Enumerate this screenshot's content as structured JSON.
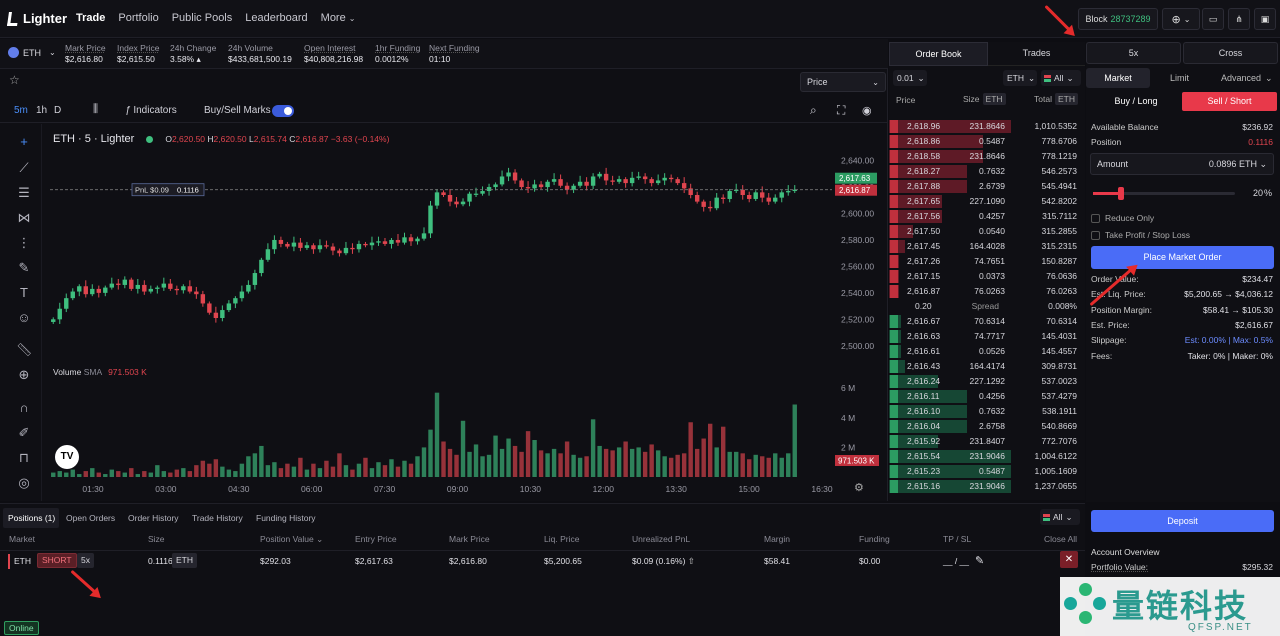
{
  "app": {
    "name": "Lighter"
  },
  "nav": {
    "items": [
      "Trade",
      "Portfolio",
      "Public Pools",
      "Leaderboard",
      "More"
    ]
  },
  "block": {
    "label": "Block",
    "number": "28737289"
  },
  "market": {
    "symbol": "ETH"
  },
  "ticker": [
    {
      "label": "Mark Price",
      "value": "$2,616.80"
    },
    {
      "label": "Index Price",
      "value": "$2,615.50"
    },
    {
      "label": "24h Change",
      "value": "3.58%"
    },
    {
      "label": "24h Volume",
      "value": "$433,681,500.19"
    },
    {
      "label": "Open Interest",
      "value": "$40,808,216.98"
    },
    {
      "label": "1hr Funding",
      "value": "0.0012%"
    },
    {
      "label": "Next Funding",
      "value": "01:10"
    }
  ],
  "chart_toolbar": {
    "intervals": [
      "5m",
      "1h",
      "D"
    ],
    "indicators": "Indicators",
    "marks": "Buy/Sell Marks",
    "price_select": "Price"
  },
  "chart_data": {
    "type": "candlestick",
    "title": "ETH · 5 · Lighter",
    "ohlc": {
      "o": "2,620.50",
      "h": "2,620.50",
      "l": "2,615.74",
      "c": "2,616.87",
      "change": "−3.63 (−0.14%)"
    },
    "ylim": [
      2490,
      2645
    ],
    "yticks": [
      "2,640.00",
      "2,620.00",
      "2,600.00",
      "2,580.00",
      "2,560.00",
      "2,540.00",
      "2,520.00",
      "2,500.00"
    ],
    "xticks": [
      "01:30",
      "03:00",
      "04:30",
      "06:00",
      "07:30",
      "09:00",
      "10:30",
      "12:00",
      "13:30",
      "15:00",
      "16:30"
    ],
    "price_labels": {
      "last": "2,617.63",
      "mark": "2,616.87"
    },
    "pnl_label": "PnL $0.09",
    "position_size": "0.1116",
    "volume": {
      "label": "Volume",
      "sma_label": "SMA",
      "sma": "971.503 K",
      "yticks": [
        "6 M",
        "4 M",
        "2 M"
      ],
      "last": "971.503 K"
    },
    "closes": [
      2520,
      2528,
      2536,
      2541,
      2545,
      2539,
      2543,
      2540,
      2544,
      2547,
      2546,
      2550,
      2543,
      2546,
      2541,
      2543,
      2544,
      2547,
      2543,
      2542,
      2545,
      2541,
      2539,
      2532,
      2525,
      2521,
      2527,
      2532,
      2536,
      2541,
      2546,
      2555,
      2565,
      2573,
      2580,
      2577,
      2575,
      2578,
      2574,
      2576,
      2573,
      2576,
      2575,
      2572,
      2570,
      2574,
      2573,
      2577,
      2576,
      2578,
      2579,
      2577,
      2580,
      2578,
      2582,
      2579,
      2581,
      2585,
      2606,
      2616,
      2614,
      2609,
      2607,
      2609,
      2615,
      2615,
      2617,
      2620,
      2622,
      2628,
      2631,
      2625,
      2620,
      2619,
      2622,
      2620,
      2624,
      2626,
      2621,
      2618,
      2621,
      2624,
      2621,
      2628,
      2630,
      2625,
      2624,
      2626,
      2623,
      2627,
      2628,
      2626,
      2623,
      2625,
      2627,
      2626,
      2623,
      2619,
      2614,
      2609,
      2605,
      2604,
      2612,
      2611,
      2617,
      2618,
      2614,
      2611,
      2616,
      2612,
      2609,
      2612,
      2616,
      2617,
      2618
    ],
    "volumes": [
      0.3,
      0.4,
      0.3,
      0.5,
      0.2,
      0.4,
      0.6,
      0.3,
      0.2,
      0.5,
      0.4,
      0.3,
      0.6,
      0.2,
      0.4,
      0.3,
      0.8,
      0.4,
      0.3,
      0.5,
      0.6,
      0.4,
      0.8,
      1.1,
      0.9,
      1.2,
      0.7,
      0.5,
      0.4,
      0.9,
      1.4,
      1.6,
      2.1,
      0.8,
      1.0,
      0.6,
      0.9,
      0.7,
      1.3,
      0.5,
      0.9,
      0.6,
      1.1,
      0.7,
      1.6,
      0.8,
      0.5,
      0.9,
      1.3,
      0.6,
      1.0,
      0.8,
      1.2,
      0.7,
      1.1,
      0.9,
      1.4,
      2.0,
      3.2,
      5.7,
      2.4,
      1.9,
      1.5,
      3.8,
      1.7,
      2.2,
      1.4,
      1.5,
      2.8,
      1.9,
      2.6,
      2.1,
      1.7,
      3.1,
      2.5,
      1.8,
      1.6,
      1.9,
      1.6,
      2.4,
      1.5,
      1.3,
      1.4,
      3.9,
      2.1,
      1.9,
      1.8,
      2.0,
      2.4,
      1.9,
      2.0,
      1.7,
      2.2,
      1.8,
      1.4,
      1.3,
      1.5,
      1.6,
      3.7,
      1.9,
      2.6,
      3.6,
      2.0,
      3.4,
      1.7,
      1.7,
      1.6,
      1.2,
      1.5,
      1.4,
      1.3,
      1.6,
      1.3,
      1.6,
      4.9
    ]
  },
  "orderbook": {
    "tabs": [
      "Order Book",
      "Trades"
    ],
    "tick": "0.01",
    "asset": "ETH",
    "filter": "All",
    "headers": {
      "price": "Price",
      "size": "Size",
      "total": "Total",
      "unit": "ETH"
    },
    "asks": [
      {
        "price": "2,618.96",
        "size": "231.8646",
        "total": "1,010.5352",
        "depth": 0.62
      },
      {
        "price": "2,618.86",
        "size": "0.5487",
        "total": "778.6706",
        "depth": 0.48
      },
      {
        "price": "2,618.58",
        "size": "231.8646",
        "total": "778.1219",
        "depth": 0.48
      },
      {
        "price": "2,618.27",
        "size": "0.7632",
        "total": "546.2573",
        "depth": 0.4
      },
      {
        "price": "2,617.88",
        "size": "2.6739",
        "total": "545.4941",
        "depth": 0.4
      },
      {
        "price": "2,617.65",
        "size": "227.1090",
        "total": "542.8202",
        "depth": 0.27
      },
      {
        "price": "2,617.56",
        "size": "0.4257",
        "total": "315.7112",
        "depth": 0.27
      },
      {
        "price": "2,617.50",
        "size": "0.0540",
        "total": "315.2855",
        "depth": 0.12
      },
      {
        "price": "2,617.45",
        "size": "164.4028",
        "total": "315.2315",
        "depth": 0.08
      },
      {
        "price": "2,617.26",
        "size": "74.7651",
        "total": "150.8287",
        "depth": 0.05
      },
      {
        "price": "2,617.15",
        "size": "0.0373",
        "total": "76.0636",
        "depth": 0.05
      },
      {
        "price": "2,616.87",
        "size": "76.0263",
        "total": "76.0263",
        "depth": 0.05
      }
    ],
    "spread": {
      "value": "0.20",
      "label": "Spread",
      "pct": "0.008%"
    },
    "bids": [
      {
        "price": "2,616.67",
        "size": "70.6314",
        "total": "70.6314",
        "depth": 0.06
      },
      {
        "price": "2,616.63",
        "size": "74.7717",
        "total": "145.4031",
        "depth": 0.06
      },
      {
        "price": "2,616.61",
        "size": "0.0526",
        "total": "145.4557",
        "depth": 0.06
      },
      {
        "price": "2,616.43",
        "size": "164.4174",
        "total": "309.8731",
        "depth": 0.08
      },
      {
        "price": "2,616.24",
        "size": "227.1292",
        "total": "537.0023",
        "depth": 0.25
      },
      {
        "price": "2,616.11",
        "size": "0.4256",
        "total": "537.4279",
        "depth": 0.4
      },
      {
        "price": "2,616.10",
        "size": "0.7632",
        "total": "538.1911",
        "depth": 0.4
      },
      {
        "price": "2,616.04",
        "size": "2.6758",
        "total": "540.8669",
        "depth": 0.4
      },
      {
        "price": "2,615.92",
        "size": "231.8407",
        "total": "772.7076",
        "depth": 0.25
      },
      {
        "price": "2,615.54",
        "size": "231.9046",
        "total": "1,004.6122",
        "depth": 0.62
      },
      {
        "price": "2,615.23",
        "size": "0.5487",
        "total": "1,005.1609",
        "depth": 0.62
      },
      {
        "price": "2,615.16",
        "size": "231.9046",
        "total": "1,237.0655",
        "depth": 0.62
      }
    ]
  },
  "trade": {
    "leverage": "5x",
    "margin_mode": "Cross",
    "order_tabs": [
      "Market",
      "Limit",
      "Advanced"
    ],
    "buy": "Buy / Long",
    "sell": "Sell / Short",
    "available_balance": {
      "label": "Available Balance",
      "value": "$236.92"
    },
    "position": {
      "label": "Position",
      "value": "0.1116"
    },
    "amount": {
      "label": "Amount",
      "value": "0.0896",
      "unit": "ETH"
    },
    "slider": {
      "percent": 20,
      "display": "20",
      "unit": "%"
    },
    "reduce_only": "Reduce Only",
    "tpsl": "Take Profit / Stop Loss",
    "submit": "Place Market Order",
    "details": [
      {
        "label": "Order Value:",
        "value": "$234.47"
      },
      {
        "label": "Est. Liq. Price:",
        "value": "$5,200.65 → $4,036.12"
      },
      {
        "label": "Position Margin:",
        "value": "$58.41 → $105.30"
      },
      {
        "label": "Est. Price:",
        "value": "$2,616.67"
      },
      {
        "label": "Slippage:",
        "value": "Est: 0.00% | Max: 0.5%"
      },
      {
        "label": "Fees:",
        "value": "Taker: 0% | Maker: 0%"
      }
    ],
    "deposit": "Deposit",
    "account_overview": "Account Overview",
    "portfolio_value": {
      "label": "Portfolio Value:",
      "value": "$295.32"
    }
  },
  "positions": {
    "tabs": [
      "Positions (1)",
      "Open Orders",
      "Order History",
      "Trade History",
      "Funding History"
    ],
    "filter": "All",
    "headers": [
      "Market",
      "Size",
      "Position Value",
      "Entry Price",
      "Mark Price",
      "Liq. Price",
      "Unrealized PnL",
      "Margin",
      "Funding",
      "TP / SL"
    ],
    "close_all": "Close All",
    "row": {
      "market": "ETH",
      "side": "SHORT",
      "leverage": "5x",
      "size": "0.1116",
      "unit": "ETH",
      "value": "$292.03",
      "entry": "$2,617.63",
      "mark": "$2,616.80",
      "liq": "$5,200.65",
      "pnl": "$0.09 (0.16%)",
      "margin": "$58.41",
      "funding": "$0.00",
      "tpsl": "__ / __"
    }
  },
  "status": {
    "online": "Online"
  },
  "watermark": {
    "text": "量链科技",
    "sub": "QFSP.NET"
  },
  "colors": {
    "green": "#3fbf7f",
    "red": "#e0454f",
    "accent": "#4a6cf7",
    "sell": "#e8394a"
  }
}
